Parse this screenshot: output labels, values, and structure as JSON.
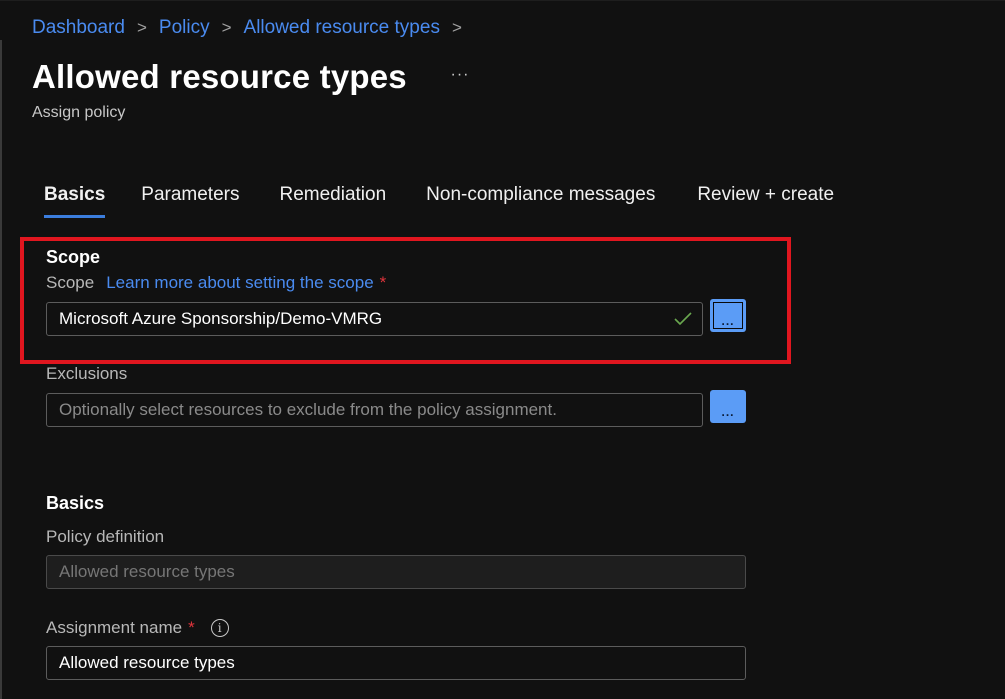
{
  "breadcrumb": [
    {
      "label": "Dashboard"
    },
    {
      "label": "Policy"
    },
    {
      "label": "Allowed resource types"
    }
  ],
  "breadcrumb_separator": ">",
  "header": {
    "title": "Allowed resource types",
    "more_label": "···",
    "subtitle": "Assign policy"
  },
  "tabs": [
    {
      "label": "Basics",
      "active": true
    },
    {
      "label": "Parameters",
      "active": false
    },
    {
      "label": "Remediation",
      "active": false
    },
    {
      "label": "Non-compliance messages",
      "active": false
    },
    {
      "label": "Review + create",
      "active": false
    }
  ],
  "scope_section": {
    "heading": "Scope",
    "scope_label": "Scope",
    "learn_more_link": "Learn more about setting the scope",
    "required_mark": "*",
    "scope_value": "Microsoft Azure Sponsorship/Demo-VMRG",
    "scope_valid": true,
    "browse_label": "...",
    "exclusions_label": "Exclusions",
    "exclusions_placeholder": "Optionally select resources to exclude from the policy assignment.",
    "exclusions_browse_label": "..."
  },
  "basics_section": {
    "heading": "Basics",
    "policy_definition_label": "Policy definition",
    "policy_definition_value": "Allowed resource types",
    "assignment_name_label": "Assignment name",
    "required_mark": "*",
    "assignment_name_value": "Allowed resource types",
    "info_icon": "i"
  },
  "colors": {
    "link": "#4a8bf0",
    "accent": "#3b7ddd",
    "highlight": "#e0161f",
    "button": "#5b9cf6",
    "required": "#e0343c",
    "valid_check": "#6aa84f"
  }
}
